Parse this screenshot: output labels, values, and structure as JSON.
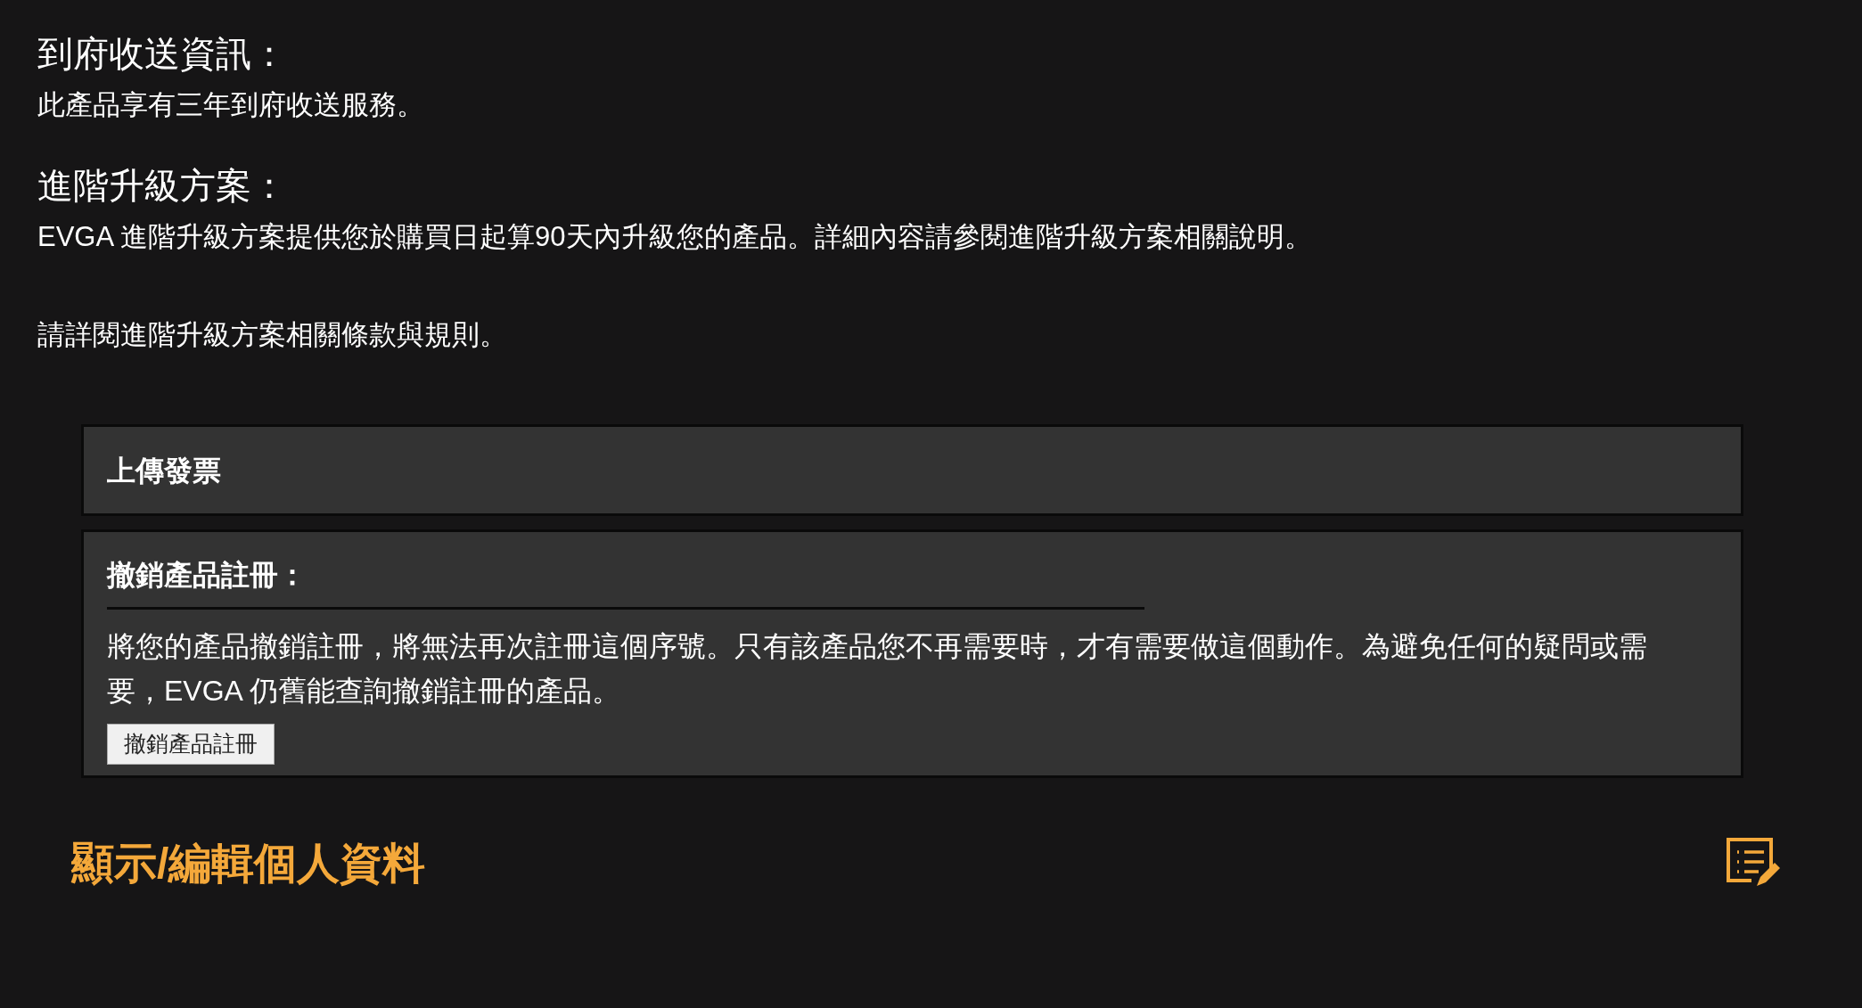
{
  "sections": [
    {
      "title": "到府收送資訊：",
      "paragraphs": [
        "此產品享有三年到府收送服務。"
      ]
    },
    {
      "title": "進階升級方案：",
      "paragraphs": [
        "EVGA 進階升級方案提供您於購買日起算90天內升級您的產品。詳細內容請參閱進階升級方案相關說明。",
        "請詳閱進階升級方案相關條款與規則。"
      ]
    }
  ],
  "upload_panel": {
    "title": "上傳發票"
  },
  "unregister_panel": {
    "title": "撤銷產品註冊：",
    "description": "將您的產品撤銷註冊，將無法再次註冊這個序號。只有該產品您不再需要時，才有需要做這個動作。為避免任何的疑問或需要，EVGA 仍舊能查詢撤銷註冊的產品。",
    "button": "撤銷產品註冊"
  },
  "profile": {
    "title": "顯示/編輯個人資料"
  }
}
